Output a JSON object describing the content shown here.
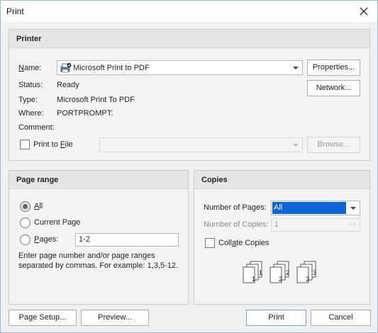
{
  "window": {
    "title": "Print"
  },
  "printer": {
    "header": "Printer",
    "name_label": "Name:",
    "name_value": "Microsoft Print to PDF",
    "status_label": "Status:",
    "status_value": "Ready",
    "type_label": "Type:",
    "type_value": "Microsoft Print To PDF",
    "where_label": "Where:",
    "where_value": "PORTPROMPT:",
    "comment_label": "Comment:",
    "comment_value": "",
    "print_to_file_label": "Print to File",
    "properties_button": "Properties...",
    "network_button": "Network...",
    "browse_button": "Browse..."
  },
  "page_range": {
    "header": "Page range",
    "all_label": "All",
    "current_page_label": "Current Page",
    "pages_label": "Pages:",
    "pages_value": "1-2",
    "hint_line1": "Enter page number and/or page ranges",
    "hint_line2": "separated by commas. For example: 1,3,5-12."
  },
  "copies": {
    "header": "Copies",
    "number_of_pages_label": "Number of Pages:",
    "number_of_pages_value": "All",
    "number_of_copies_label": "Number of Copies:",
    "number_of_copies_value": "1",
    "collate_label": "Collate Copies",
    "collate_digits": [
      "1",
      "2",
      "3"
    ]
  },
  "footer": {
    "page_setup_button": "Page Setup...",
    "preview_button": "Preview...",
    "print_button": "Print",
    "cancel_button": "Cancel"
  },
  "colors": {
    "selection": "#0a64d8",
    "primary_border": "#7ca3d6"
  }
}
